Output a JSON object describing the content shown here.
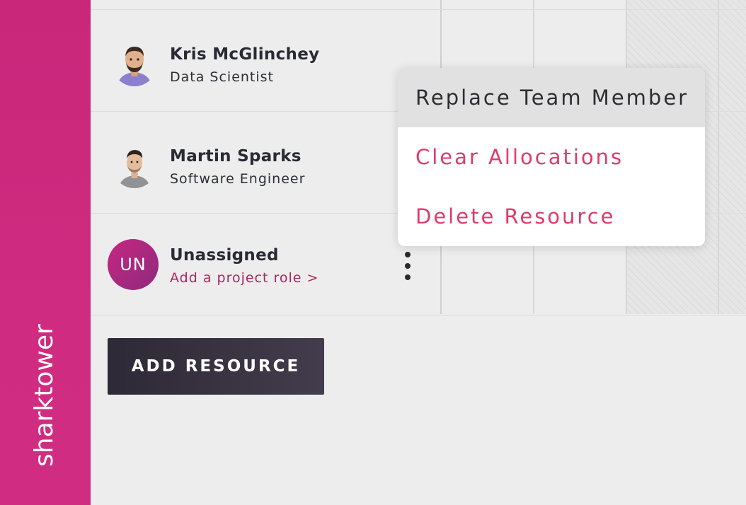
{
  "app": {
    "brand": "sharktower"
  },
  "resources": [
    {
      "name": "Kris McGlinchey",
      "role": "Data Scientist"
    },
    {
      "name": "Martin Sparks",
      "role": "Software Engineer"
    },
    {
      "name": "Unassigned",
      "role": "Add a project role >",
      "initials": "UN"
    }
  ],
  "add_button": {
    "label": "ADD RESOURCE"
  },
  "context_menu": {
    "items": [
      {
        "label": "Replace Team Member"
      },
      {
        "label": "Clear Allocations"
      },
      {
        "label": "Delete Resource"
      }
    ]
  },
  "colors": {
    "brand": "#cf2b80",
    "accent": "#e03a6b",
    "button": "#3a3441"
  }
}
